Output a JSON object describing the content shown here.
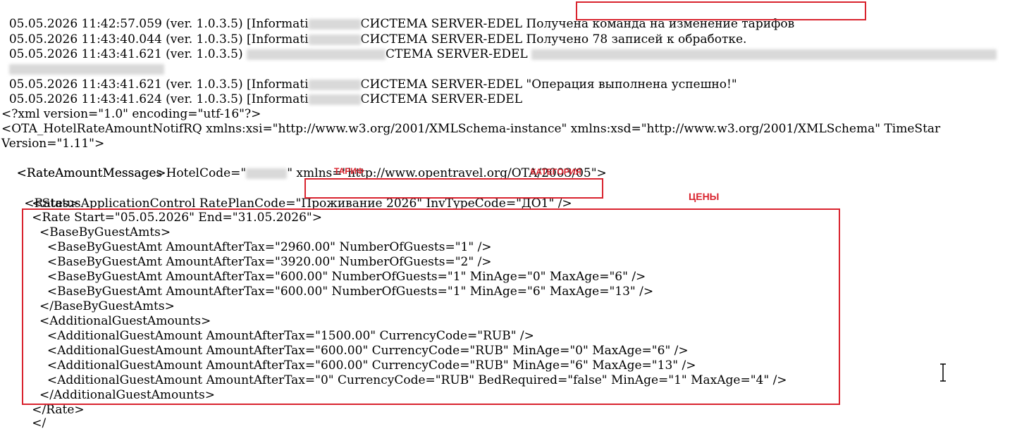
{
  "log": {
    "lines": [
      {
        "pre": "05.05.2026 11:42:57.059 (ver. 1.0.3.5) [Informati",
        "mid": "СИСТЕМА SERVER-EDEL ",
        "msg": "Получена команда на изменение тарифов"
      },
      {
        "pre": "05.05.2026 11:43:40.044 (ver. 1.0.3.5) [Informati",
        "mid": "СИСТЕМА SERVER-EDEL ",
        "msg": "Получено 78 записей к обработке."
      },
      {
        "pre": "05.05.2026 11:43:41.621 (ver. 1.0.3.5) ",
        "mid": "СТЕМА SERVER-EDEL ",
        "msg": ""
      },
      {
        "pre": "05.05.2026 11:43:41.621 (ver. 1.0.3.5) [Informati",
        "mid": "СИСТЕМА SERVER-EDEL ",
        "msg": "\"Операция выполнена успешно!\""
      },
      {
        "pre": "05.05.2026 11:43:41.624 (ver. 1.0.3.5) [Informati",
        "mid": "СИСТЕМА SERVER-EDEL",
        "msg": ""
      }
    ]
  },
  "xml": {
    "decl": "<?xml version=\"1.0\" encoding=\"utf-16\"?>",
    "root_open": "<OTA_HotelRateAmountNotifRQ xmlns:xsi=\"http://www.w3.org/2001/XMLSchema-instance\" xmlns:xsd=\"http://www.w3.org/2001/XMLSchema\" TimeStar",
    "version": "Version=\"1.11\">",
    "messages_pre": "  <RateAmountMessages HotelCode=\"",
    "messages_post": "\" xmlns=\"http://www.opentravel.org/OTA/2003/05\">",
    "message_open": "    <RateAmountMessage>",
    "status_pre": "      <StatusApplicationControl RatePlanCode=",
    "status_val": "\"Проживание 2026\" InvTypeCode=\"ДО1\" />",
    "rates_open": "      <Rates>",
    "rate_open": "        <Rate Start=\"05.05.2026\" End=\"31.05.2026\">",
    "base_open": "          <BaseByGuestAmts>",
    "base_1": "            <BaseByGuestAmt AmountAfterTax=\"2960.00\" NumberOfGuests=\"1\" />",
    "base_2": "            <BaseByGuestAmt AmountAfterTax=\"3920.00\" NumberOfGuests=\"2\" />",
    "base_3": "            <BaseByGuestAmt AmountAfterTax=\"600.00\" NumberOfGuests=\"1\" MinAge=\"0\" MaxAge=\"6\" />",
    "base_4": "            <BaseByGuestAmt AmountAfterTax=\"600.00\" NumberOfGuests=\"1\" MinAge=\"6\" MaxAge=\"13\" />",
    "base_close": "          </BaseByGuestAmts>",
    "add_open": "          <AdditionalGuestAmounts>",
    "add_1": "            <AdditionalGuestAmount AmountAfterTax=\"1500.00\" CurrencyCode=\"RUB\" />",
    "add_2": "            <AdditionalGuestAmount AmountAfterTax=\"600.00\" CurrencyCode=\"RUB\" MinAge=\"0\" MaxAge=\"6\" />",
    "add_3": "            <AdditionalGuestAmount AmountAfterTax=\"600.00\" CurrencyCode=\"RUB\" MinAge=\"6\" MaxAge=\"13\" />",
    "add_4": "            <AdditionalGuestAmount AmountAfterTax=\"0\" CurrencyCode=\"RUB\" BedRequired=\"false\" MinAge=\"1\" MaxAge=\"4\" />",
    "add_close": "          </AdditionalGuestAmounts>",
    "rate_close": "        </Rate>",
    "tail": "        </"
  },
  "annotations": {
    "tariff": "ТАРИФ",
    "category": "КАТЕГОРИЯ",
    "prices": "ЦЕНЫ"
  },
  "colors": {
    "highlight": "#d9232e"
  }
}
